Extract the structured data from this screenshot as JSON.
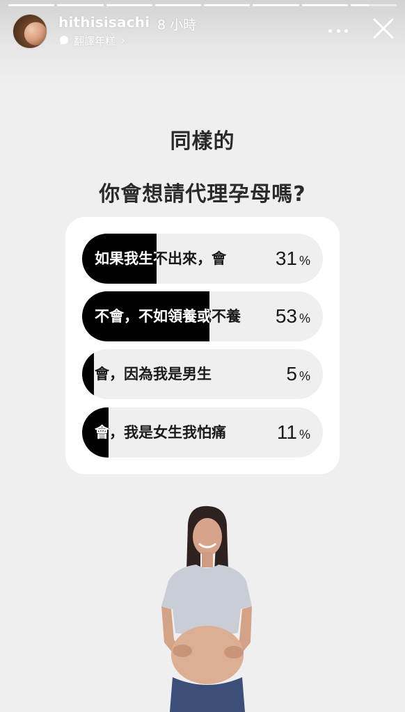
{
  "story": {
    "segments": [
      1,
      1,
      1,
      1,
      1,
      1,
      1,
      0.4
    ]
  },
  "header": {
    "username": "hithisisachi",
    "time": "8 小時",
    "translate_label": "翻譯年糕"
  },
  "content": {
    "title_line1": "同樣的",
    "title_line2": "你會想請代理孕母嗎?"
  },
  "poll": {
    "options": [
      {
        "label": "如果我生不出來，會",
        "percent": 31
      },
      {
        "label": "不會，不如領養或不養",
        "percent": 53
      },
      {
        "label": "會，因為我是男生",
        "percent": 5
      },
      {
        "label": "會，我是女生我怕痛",
        "percent": 11
      }
    ],
    "percent_symbol": "%"
  },
  "icons": {
    "more": "more-icon",
    "close": "close-icon",
    "chat_bubble": "chat-bubble-icon",
    "chevron": "chevron-right-icon"
  },
  "colors": {
    "bar": "#000000",
    "track": "#efefef",
    "card": "#ffffff",
    "background": "#efefef"
  }
}
